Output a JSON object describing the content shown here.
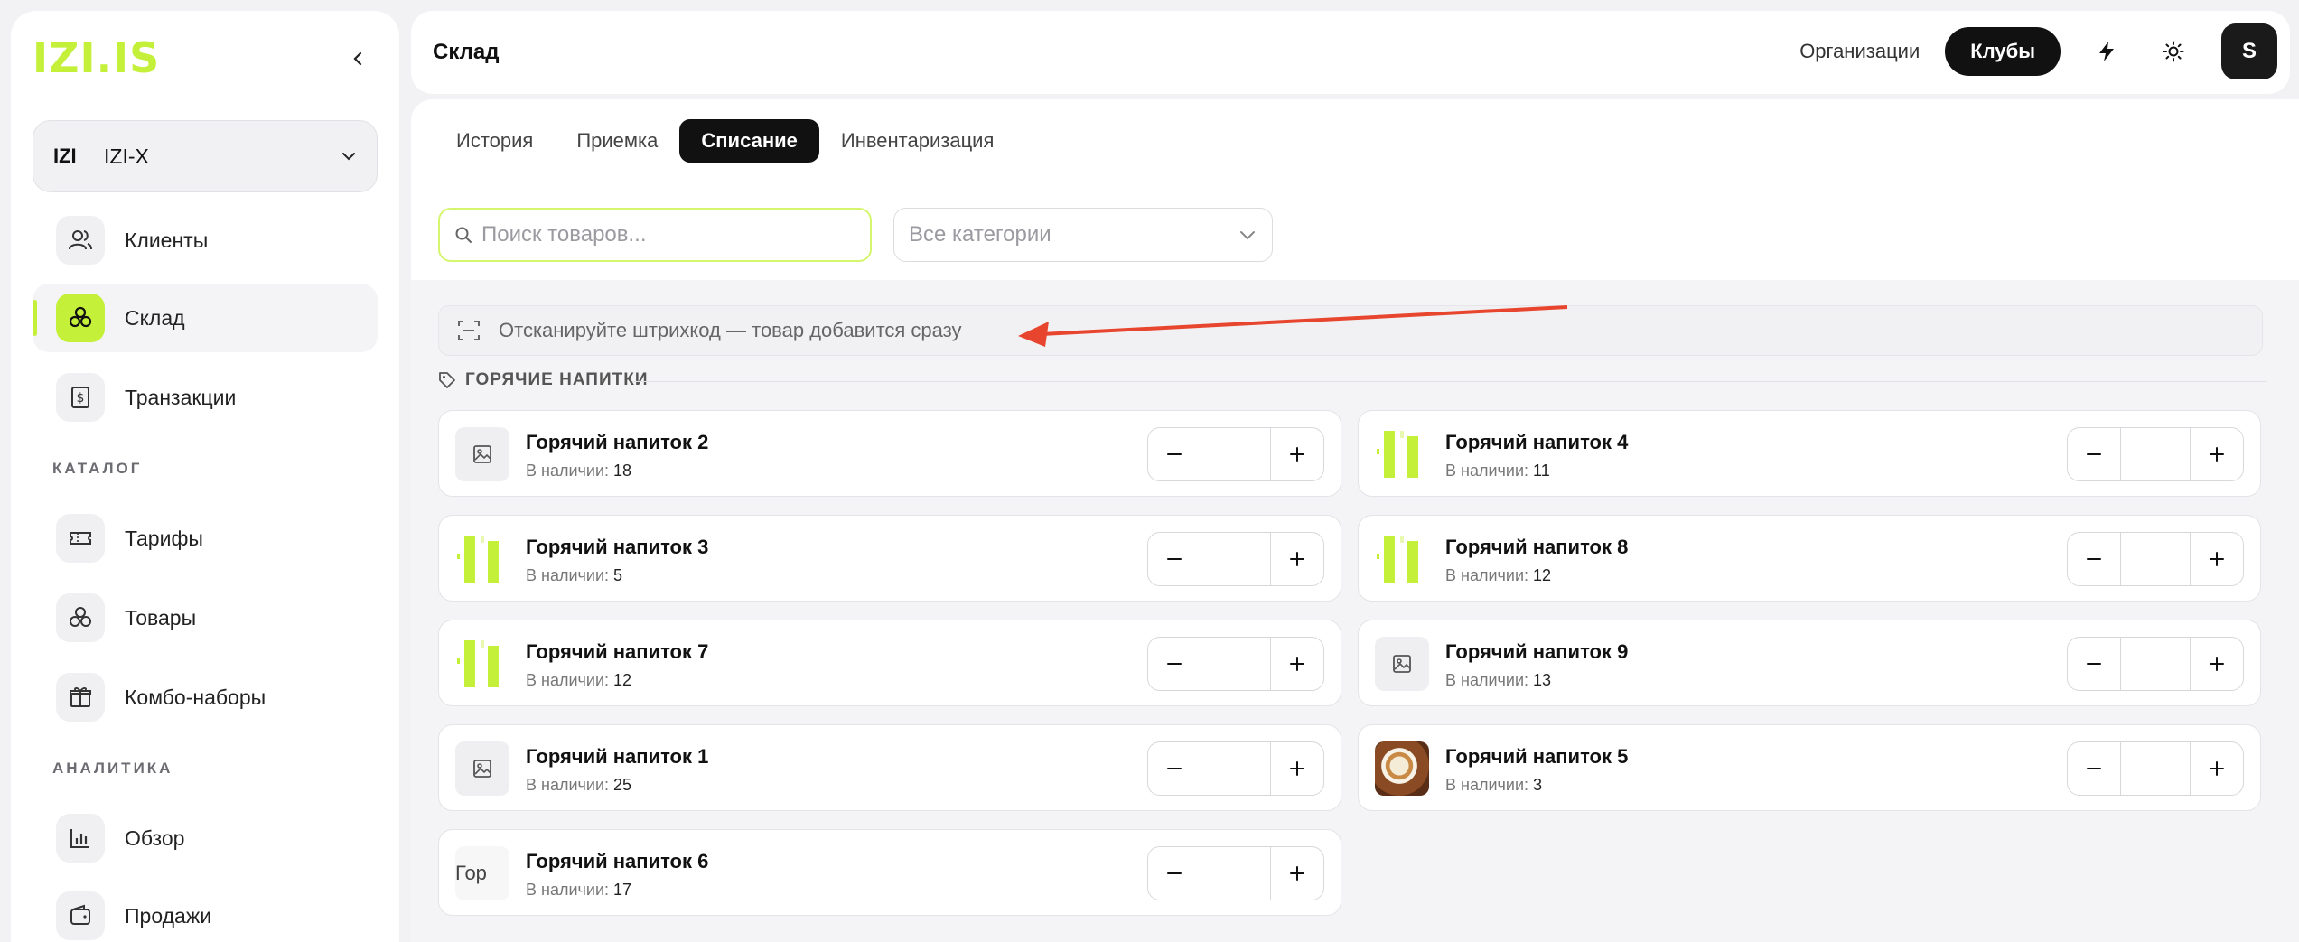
{
  "logo": {
    "text": "IZI.IS"
  },
  "org": {
    "logo": "IZI",
    "name": "IZI-X"
  },
  "sidebar": {
    "items": [
      {
        "label": "Клиенты"
      },
      {
        "label": "Склад"
      },
      {
        "label": "Транзакции"
      }
    ],
    "sections": [
      {
        "label": "КАТАЛОГ",
        "items": [
          {
            "label": "Тарифы"
          },
          {
            "label": "Товары"
          },
          {
            "label": "Комбо-наборы"
          }
        ]
      },
      {
        "label": "АНАЛИТИКА",
        "items": [
          {
            "label": "Обзор"
          },
          {
            "label": "Продажи"
          }
        ]
      }
    ]
  },
  "header": {
    "title": "Склад",
    "link_orgs": "Организации",
    "pill_clubs": "Клубы",
    "avatar": "S",
    "icons": [
      "lightning-icon",
      "sun-icon"
    ]
  },
  "tabs": [
    {
      "label": "История"
    },
    {
      "label": "Приемка"
    },
    {
      "label": "Списание"
    },
    {
      "label": "Инвентаризация"
    }
  ],
  "active_tab": "Списание",
  "search": {
    "placeholder": "Поиск товаров...",
    "value": ""
  },
  "category_select": {
    "value": "Все категории"
  },
  "scan_hint": "Отсканируйте штрихкод — товар добавится сразу",
  "group": {
    "title": "ГОРЯЧИЕ НАПИТКИ",
    "stock_label": "В наличии:",
    "products": [
      {
        "name": "Горячий напиток 2",
        "stock": "18",
        "thumb": "image-placeholder-icon"
      },
      {
        "name": "Горячий напиток 4",
        "stock": "11",
        "thumb": "green-product-image"
      },
      {
        "name": "Горячий напиток 3",
        "stock": "5",
        "thumb": "green-product-image"
      },
      {
        "name": "Горячий напиток 8",
        "stock": "12",
        "thumb": "green-product-image"
      },
      {
        "name": "Горячий напиток 7",
        "stock": "12",
        "thumb": "green-product-image"
      },
      {
        "name": "Горячий напиток 9",
        "stock": "13",
        "thumb": "image-placeholder-icon"
      },
      {
        "name": "Горячий напиток 1",
        "stock": "25",
        "thumb": "image-placeholder-icon"
      },
      {
        "name": "Горячий напиток 5",
        "stock": "3",
        "thumb": "coffee-cup-photo"
      },
      {
        "name": "Горячий напиток 6",
        "stock": "17",
        "thumb": "broken-image",
        "broken_alt": "Гор"
      }
    ]
  },
  "colors": {
    "accent": "#c4f03a",
    "dark": "#111111",
    "annotation_arrow": "#e8452f"
  }
}
